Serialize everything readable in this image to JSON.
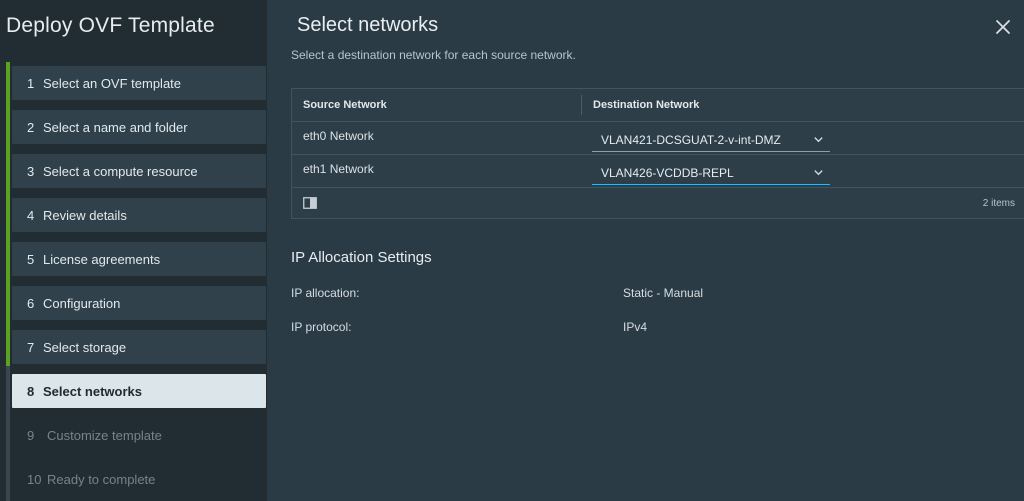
{
  "wizard": {
    "title": "Deploy OVF Template",
    "steps": [
      {
        "num": "1",
        "label": "Select an OVF template"
      },
      {
        "num": "2",
        "label": "Select a name and folder"
      },
      {
        "num": "3",
        "label": "Select a compute resource"
      },
      {
        "num": "4",
        "label": "Review details"
      },
      {
        "num": "5",
        "label": "License agreements"
      },
      {
        "num": "6",
        "label": "Configuration"
      },
      {
        "num": "7",
        "label": "Select storage"
      },
      {
        "num": "8",
        "label": "Select networks"
      },
      {
        "num": "9",
        "label": "Customize template"
      },
      {
        "num": "10",
        "label": "Ready to complete"
      }
    ]
  },
  "page": {
    "title": "Select networks",
    "subtitle": "Select a destination network for each source network."
  },
  "grid": {
    "columns": [
      "Source Network",
      "Destination Network"
    ],
    "rows": [
      {
        "source": "eth0 Network",
        "destination": "VLAN421-DCSGUAT-2-v-int-DMZ"
      },
      {
        "source": "eth1 Network",
        "destination": "VLAN426-VCDDB-REPL"
      }
    ],
    "item_count": "2 items"
  },
  "ip_settings": {
    "title": "IP Allocation Settings",
    "allocation_label": "IP allocation:",
    "allocation_value": "Static - Manual",
    "protocol_label": "IP protocol:",
    "protocol_value": "IPv4"
  },
  "colors": {
    "completed_rail": "#5aa220",
    "focus_underline": "#49afd9"
  },
  "icons": [
    "close-icon",
    "chevron-down-icon",
    "column-toggle-icon"
  ]
}
